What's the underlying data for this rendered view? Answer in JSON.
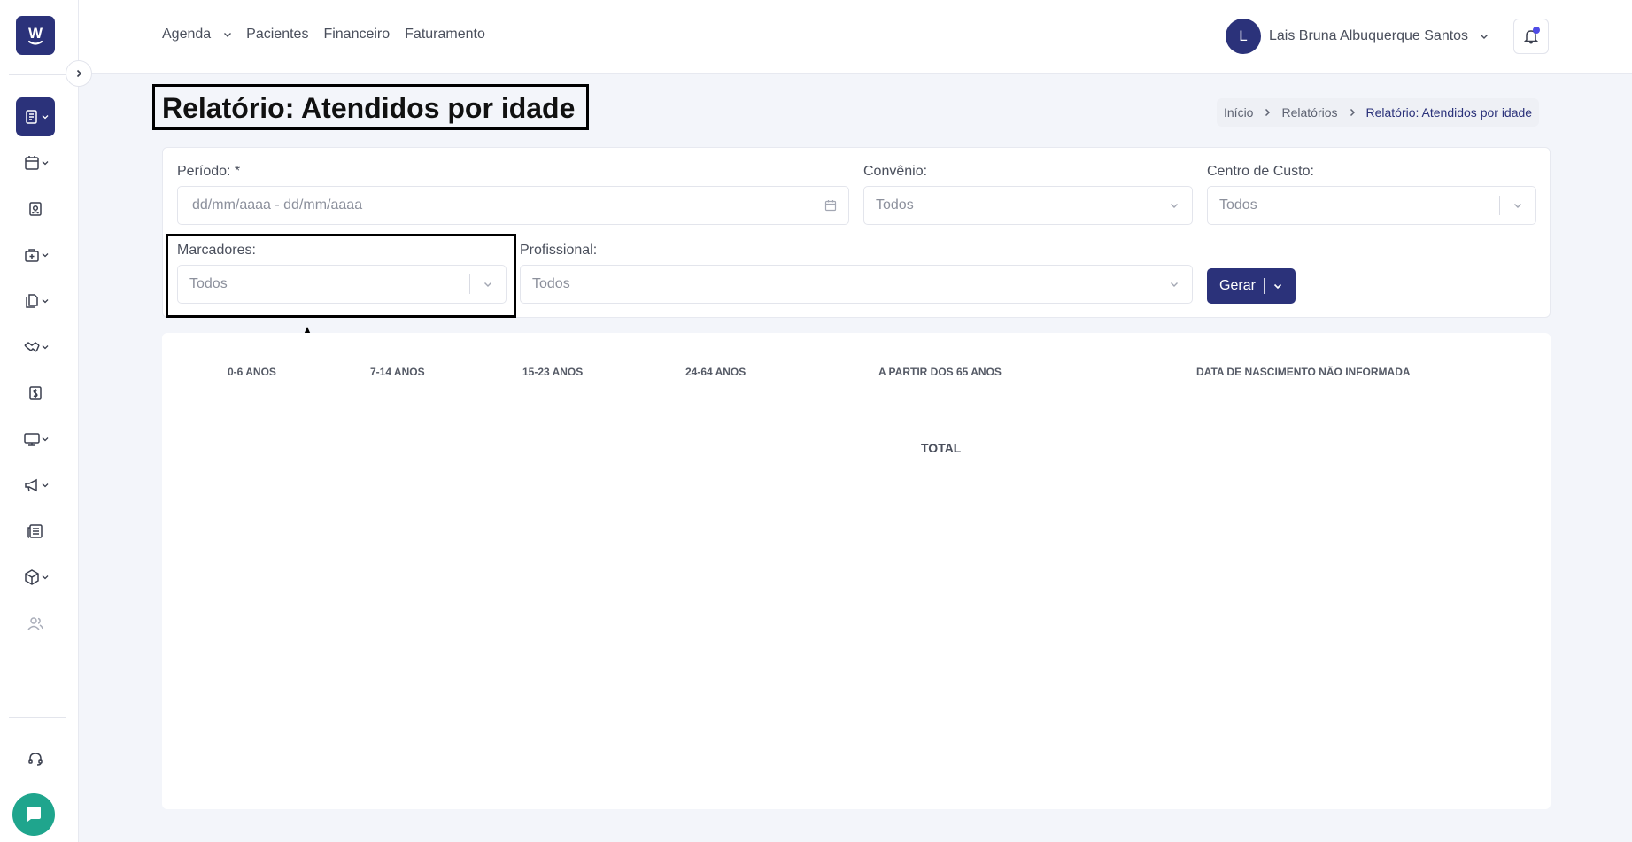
{
  "logo": {
    "letter": "W"
  },
  "topnav": {
    "agenda": "Agenda",
    "pacientes": "Pacientes",
    "financeiro": "Financeiro",
    "faturamento": "Faturamento"
  },
  "user": {
    "initial": "L",
    "name": "Lais Bruna Albuquerque Santos"
  },
  "page": {
    "title": "Relatório: Atendidos por idade"
  },
  "breadcrumb": {
    "home": "Início",
    "reports": "Relatórios",
    "current": "Relatório: Atendidos por idade"
  },
  "filters": {
    "periodo_label": "Período: *",
    "periodo_placeholder": "dd/mm/aaaa - dd/mm/aaaa",
    "convenio_label": "Convênio:",
    "convenio_value": "Todos",
    "centro_label": "Centro de Custo:",
    "centro_value": "Todos",
    "marcadores_label": "Marcadores:",
    "marcadores_value": "Todos",
    "profissional_label": "Profissional:",
    "profissional_value": "Todos",
    "gerar_label": "Gerar"
  },
  "report": {
    "columns": [
      "0-6 ANOS",
      "7-14 ANOS",
      "15-23 ANOS",
      "24-64 ANOS",
      "A PARTIR DOS 65 ANOS",
      "DATA DE NASCIMENTO NÃO INFORMADA"
    ],
    "total_label": "TOTAL"
  },
  "colors": {
    "primary": "#2b327a",
    "chat": "#1fa58d",
    "notification": "#4f4be6"
  },
  "sidebar_icons": [
    "report-icon",
    "calendar-icon",
    "patient-icon",
    "medical-bag-icon",
    "documents-icon",
    "handshake-icon",
    "dollar-icon",
    "monitor-icon",
    "megaphone-icon",
    "newspaper-icon",
    "box-icon",
    "users-icon",
    "headset-icon",
    "chat-icon"
  ]
}
